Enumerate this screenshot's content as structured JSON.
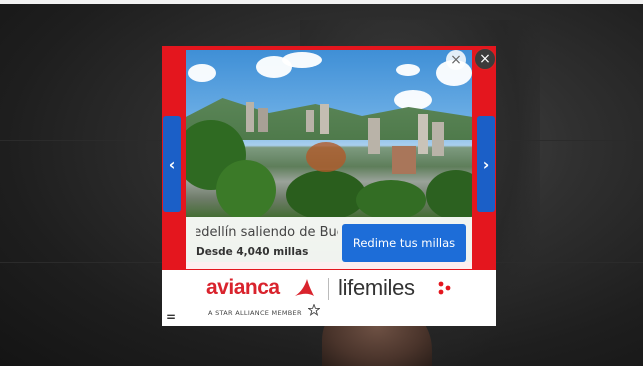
{
  "ad": {
    "caption_title": "Medellín saliendo de Bucaramanga",
    "caption_subtitle": "Desde 4,040 millas",
    "cta_label": "Redime tus millas",
    "brand_primary": "avianca",
    "brand_secondary": "lifemiles",
    "tagline": "A STAR ALLIANCE MEMBER",
    "close_glyph": "×",
    "prev_glyph": "‹",
    "next_glyph": "›",
    "menu_glyph": "=",
    "colors": {
      "frame": "#e4161e",
      "cta": "#1d6dd8",
      "nav": "#1b5fc7",
      "brand_red": "#d9232d"
    }
  },
  "overlay": {
    "close_glyph": "×"
  },
  "icons": [
    "prev-arrow-icon",
    "next-arrow-icon",
    "close-icon",
    "avianca-swoosh-icon",
    "lifemiles-dots-icon",
    "star-alliance-icon",
    "menu-icon"
  ]
}
